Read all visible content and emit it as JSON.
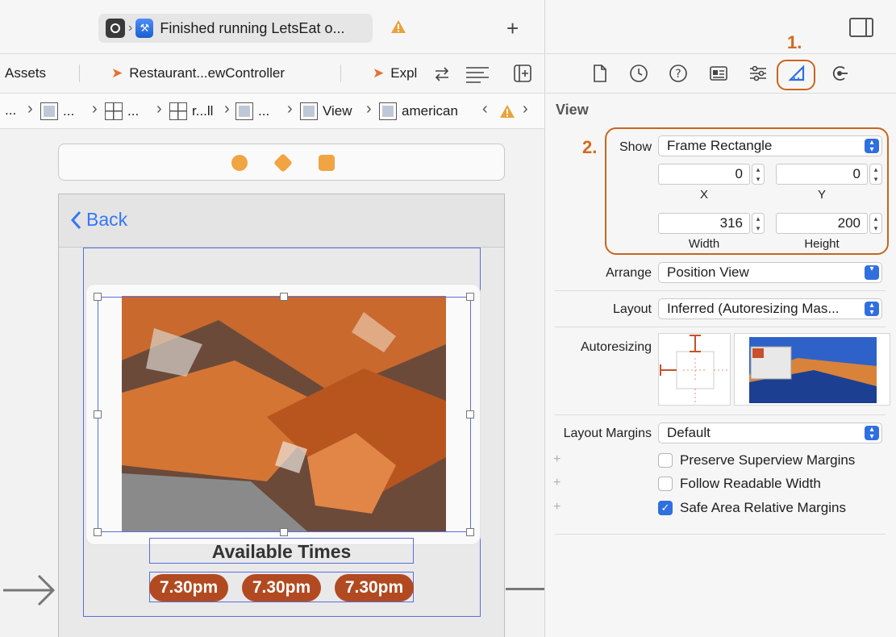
{
  "titlebar": {
    "status_text": "Finished running LetsEat o...",
    "new_tab_glyph": "+"
  },
  "tabs": [
    {
      "label": "Assets"
    },
    {
      "label": "Restaurant...ewController"
    },
    {
      "label": "Expl"
    }
  ],
  "jumpbar": {
    "items": [
      "...",
      "...",
      "...",
      "r...ll",
      "...",
      "View",
      "american"
    ]
  },
  "canvas": {
    "back_label": "Back",
    "available_times_label": "Available Times",
    "time_buttons": [
      "7.30pm",
      "7.30pm",
      "7.30pm"
    ]
  },
  "inspector": {
    "section_title": "View",
    "show_label": "Show",
    "show_value": "Frame Rectangle",
    "x_value": "0",
    "y_value": "0",
    "x_label": "X",
    "y_label": "Y",
    "width_value": "316",
    "height_value": "200",
    "width_label": "Width",
    "height_label": "Height",
    "arrange_label": "Arrange",
    "arrange_value": "Position View",
    "layout_label": "Layout",
    "layout_value": "Inferred (Autoresizing Mas...",
    "autoresizing_label": "Autoresizing",
    "layout_margins_label": "Layout Margins",
    "layout_margins_value": "Default",
    "checkboxes": [
      {
        "label": "Preserve Superview Margins",
        "checked": false
      },
      {
        "label": "Follow Readable Width",
        "checked": false
      },
      {
        "label": "Safe Area Relative Margins",
        "checked": true
      }
    ]
  },
  "callouts": {
    "step1": "1.",
    "step2": "2."
  },
  "colors": {
    "accent": "#2f6fe0",
    "callout": "#c8651e",
    "time_button": "#b24a21",
    "selection": "#5a6ee0"
  }
}
